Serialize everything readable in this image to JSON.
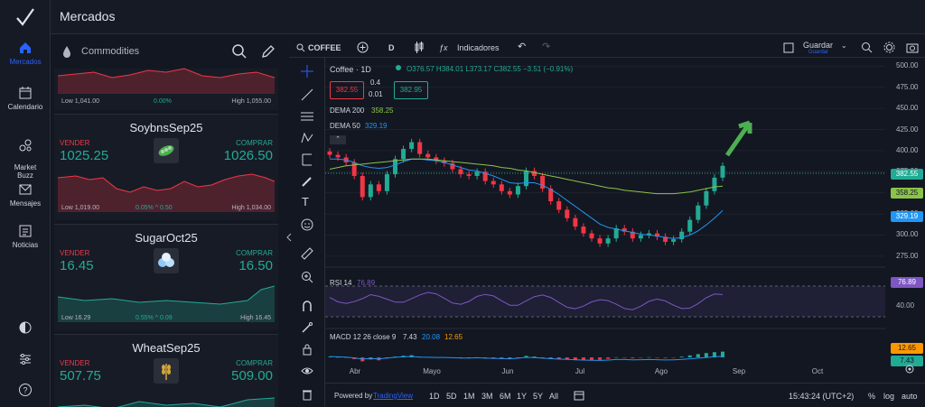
{
  "nav": {
    "items": [
      {
        "label": "Mercados",
        "icon": "home-icon"
      },
      {
        "label": "Calendario",
        "icon": "calendar-icon"
      },
      {
        "label": "Market\nBuzz",
        "icon": "buzz-icon"
      },
      {
        "label": "Mensajes",
        "icon": "mail-icon"
      },
      {
        "label": "Noticias",
        "icon": "news-icon"
      }
    ]
  },
  "header": {
    "title": "Mercados"
  },
  "list": {
    "category": "Commodities",
    "cards": [
      {
        "name": "",
        "sell_label": "",
        "buy_label": "",
        "sell_price": "",
        "buy_price": "",
        "low": "Low 1,041.00",
        "change": "0.00%",
        "high": "High 1,055.00",
        "trend": "red"
      },
      {
        "name": "SoybnsSep25",
        "sell_label": "VENDER",
        "buy_label": "COMPRAR",
        "sell_price": "1025.25",
        "buy_price": "1026.50",
        "low": "Low 1,019.00",
        "change": "0.05% ^ 0.50",
        "high": "High 1,034.00",
        "trend": "red"
      },
      {
        "name": "SugarOct25",
        "sell_label": "VENDER",
        "buy_label": "COMPRAR",
        "sell_price": "16.45",
        "buy_price": "16.50",
        "low": "Low 16.29",
        "change": "0.55% ^ 0.09",
        "high": "High 16.45",
        "trend": "green"
      },
      {
        "name": "WheatSep25",
        "sell_label": "VENDER",
        "buy_label": "COMPRAR",
        "sell_price": "507.75",
        "buy_price": "509.00",
        "low": "",
        "change": "",
        "high": "",
        "trend": "green"
      }
    ]
  },
  "chart_toolbar": {
    "symbol": "COFFEE",
    "interval": "D",
    "indicators": "Indicadores",
    "save": "Guardar",
    "save_sub": "Guardar"
  },
  "chart_legend": {
    "title": "Coffee · 1D",
    "ohlc": "O376.57 H384.01 L373.17 C382.55 −3.51 (−0.91%)",
    "bid": "382.55",
    "spread_top": "0.4",
    "spread_bottom": "0.01",
    "ask": "382.95",
    "dema200": "DEMA 200",
    "dema200_val": "358.25",
    "dema50": "DEMA 50",
    "dema50_val": "329.19",
    "rsi": "RSI 14",
    "rsi_val": "76.89",
    "macd": "MACD 12 26 close 9",
    "macd_v1": "7.43",
    "macd_v2": "20.08",
    "macd_v3": "12.65"
  },
  "chart_data": {
    "type": "line",
    "x_labels": [
      "Abr",
      "Mayo",
      "Jun",
      "Jul",
      "Ago",
      "Sep",
      "Oct"
    ],
    "price_ticks": [
      "500.00",
      "475.00",
      "450.00",
      "425.00",
      "400.00",
      "375.00",
      "350.00",
      "325.00",
      "300.00",
      "275.00"
    ],
    "rsi_tick": "40.00",
    "tags": {
      "last": "382.55",
      "dema200": "358.25",
      "dema50": "329.19",
      "rsi": "76.89",
      "macd_a": "12.65",
      "macd_b": "7.43"
    },
    "close": [
      395,
      392,
      386,
      370,
      345,
      360,
      352,
      372,
      390,
      402,
      410,
      396,
      392,
      388,
      385,
      378,
      372,
      370,
      375,
      364,
      360,
      352,
      348,
      358,
      376,
      370,
      355,
      340,
      330,
      320,
      310,
      302,
      296,
      290,
      296,
      308,
      304,
      296,
      300,
      302,
      298,
      292,
      295,
      304,
      318,
      335,
      352,
      368,
      382
    ],
    "dema50": [
      390,
      390,
      389,
      386,
      382,
      380,
      379,
      380,
      383,
      387,
      390,
      390,
      389,
      388,
      386,
      383,
      380,
      377,
      376,
      373,
      370,
      366,
      362,
      361,
      362,
      362,
      359,
      354,
      348,
      341,
      334,
      327,
      320,
      313,
      309,
      307,
      305,
      303,
      301,
      300,
      299,
      297,
      296,
      297,
      300,
      305,
      312,
      320,
      329
    ],
    "dema200": [
      378,
      380,
      382,
      383,
      384,
      385,
      386,
      387,
      388,
      389,
      390,
      390,
      390,
      389,
      388,
      387,
      386,
      385,
      384,
      383,
      382,
      380,
      379,
      377,
      376,
      374,
      372,
      370,
      368,
      366,
      364,
      362,
      360,
      358,
      356,
      355,
      353,
      352,
      351,
      350,
      349,
      349,
      349,
      350,
      351,
      353,
      355,
      357,
      358
    ],
    "ylim": [
      262,
      510
    ]
  },
  "bottom_bar": {
    "powered": "Powered by",
    "powered_link": "TradingView",
    "ranges": [
      "1D",
      "5D",
      "1M",
      "3M",
      "6M",
      "1Y",
      "5Y",
      "All"
    ],
    "time": "15:43:24 (UTC+2)",
    "pct": "%",
    "log": "log",
    "auto": "auto"
  },
  "colors": {
    "up": "#22ab94",
    "down": "#f23645",
    "dema50": "#2196f3",
    "dema200": "#8bc34a",
    "rsi": "#7e57c2",
    "accent": "#2962ff"
  }
}
